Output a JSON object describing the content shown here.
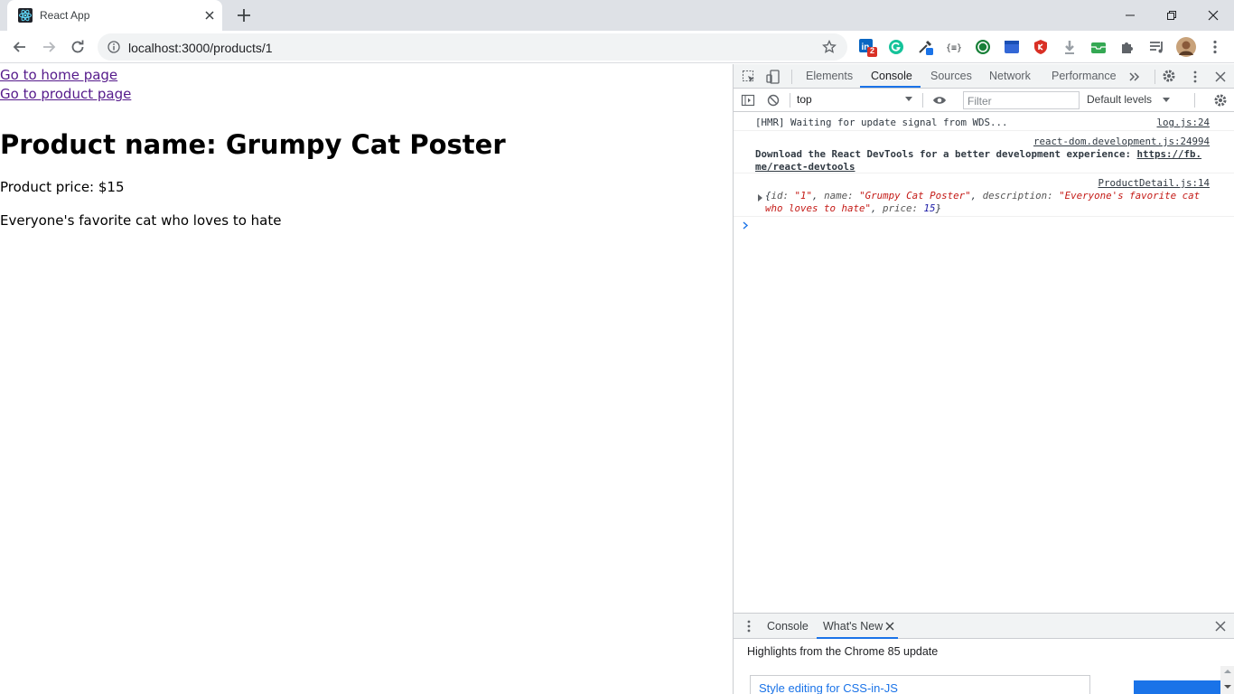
{
  "browser": {
    "tab_title": "React App",
    "url": "localhost:3000/products/1",
    "extension_badge": "2"
  },
  "page": {
    "links": [
      {
        "label": "Go to home page"
      },
      {
        "label": "Go to product page"
      }
    ],
    "heading": "Product name: Grumpy Cat Poster",
    "price": "Product price: $15",
    "description": "Everyone's favorite cat who loves to hate"
  },
  "devtools": {
    "tabs": [
      "Elements",
      "Console",
      "Sources",
      "Network",
      "Performance"
    ],
    "active_tab": "Console",
    "context": "top",
    "filter_placeholder": "Filter",
    "levels": "Default levels",
    "messages": [
      {
        "text": "[HMR] Waiting for update signal from WDS...",
        "source": "log.js:24"
      },
      {
        "text_bold": "Download the React DevTools for a better development experience: ",
        "link": "https://fb.me/react-devtools",
        "link_line1": "https://fb.",
        "link_line2": "me/react-devtools",
        "source": "react-dom.development.js:24994"
      },
      {
        "source": "ProductDetail.js:14",
        "object": {
          "id": "\"1\"",
          "name": "\"Grumpy Cat Poster\"",
          "description_1": "\"Everyone's favorite cat",
          "description_2": "who loves to hate\"",
          "price": "15"
        }
      }
    ],
    "drawer": {
      "tabs": [
        "Console",
        "What's New"
      ],
      "active_tab": "What's New",
      "highlights": "Highlights from the Chrome 85 update",
      "feature_title": "Style editing for CSS-in-JS"
    }
  },
  "colors": {
    "link_visited": "#551a8b",
    "devtools_accent": "#1a73e8",
    "string_red": "#c41a16",
    "number_blue": "#1a1aa6"
  }
}
